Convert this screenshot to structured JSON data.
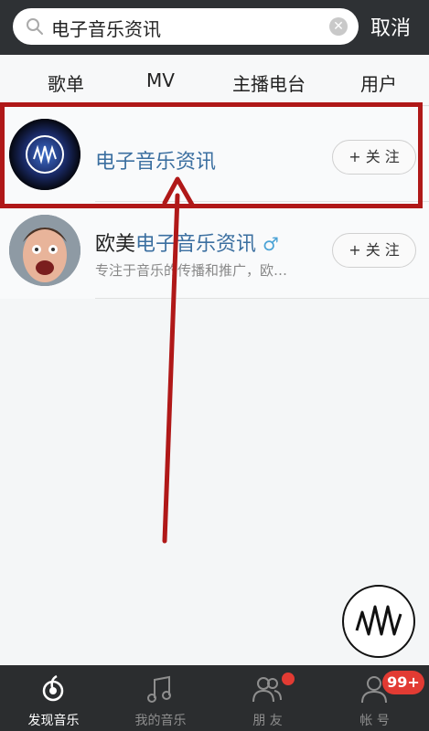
{
  "search": {
    "query": "电子音乐资讯",
    "cancel_label": "取消"
  },
  "tabs": [
    {
      "label": "歌单"
    },
    {
      "label": "MV"
    },
    {
      "label": "主播电台"
    },
    {
      "label": "用户",
      "active": true
    }
  ],
  "results": [
    {
      "name": "电子音乐资讯",
      "follow_label": "+ 关 注"
    },
    {
      "name_prefix": "欧美",
      "name_highlight": "电子音乐资讯",
      "gender": "♂",
      "description": "专注于音乐的传播和推广，欧…",
      "follow_label": "+ 关 注"
    }
  ],
  "bottom_nav": [
    {
      "label": "发现音乐",
      "icon": "discover-icon",
      "active": true
    },
    {
      "label": "我的音乐",
      "icon": "music-note-icon"
    },
    {
      "label": "朋 友",
      "icon": "friends-icon"
    },
    {
      "label": "帐 号",
      "icon": "account-icon",
      "badge": "99+"
    }
  ],
  "colors": {
    "accent": "#b01818",
    "highlight_text": "#3b6fa0",
    "header": "#2e3134"
  }
}
